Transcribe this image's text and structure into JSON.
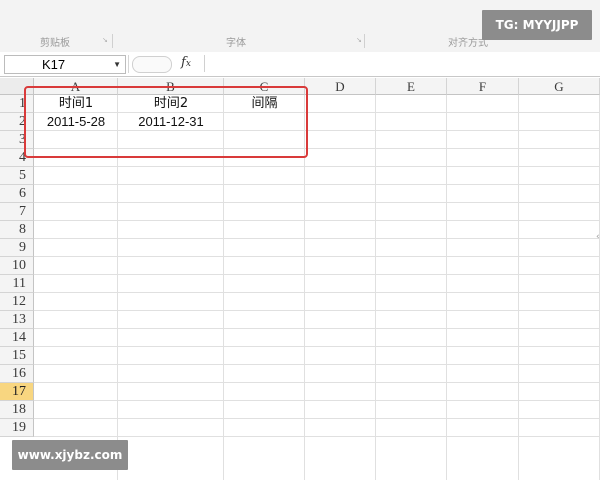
{
  "ribbon": {
    "groups": [
      "剪贴板",
      "字体",
      "对齐方式"
    ]
  },
  "watermarks": {
    "top": "TG: MYYJJPP",
    "bottom": "www.xjybz.com"
  },
  "formula_bar": {
    "name_box": "K17",
    "fx_icon": "fx-icon",
    "formula": ""
  },
  "sheet": {
    "columns": [
      "A",
      "B",
      "C",
      "D",
      "E",
      "F",
      "G"
    ],
    "rows": [
      "1",
      "2",
      "3",
      "4",
      "5",
      "6",
      "7",
      "8",
      "9",
      "10",
      "11",
      "12",
      "13",
      "14",
      "15",
      "16",
      "17",
      "18",
      "19"
    ],
    "active_row": "17",
    "cells": {
      "A1": "时间1",
      "B1": "时间2",
      "C1": "间隔",
      "A2": "2011-5-28",
      "B2": "2011-12-31"
    }
  },
  "colors": {
    "highlight_border": "#d93a3a",
    "active_row_header": "#f8d680",
    "watermark_bg": "#8c8c8c"
  }
}
